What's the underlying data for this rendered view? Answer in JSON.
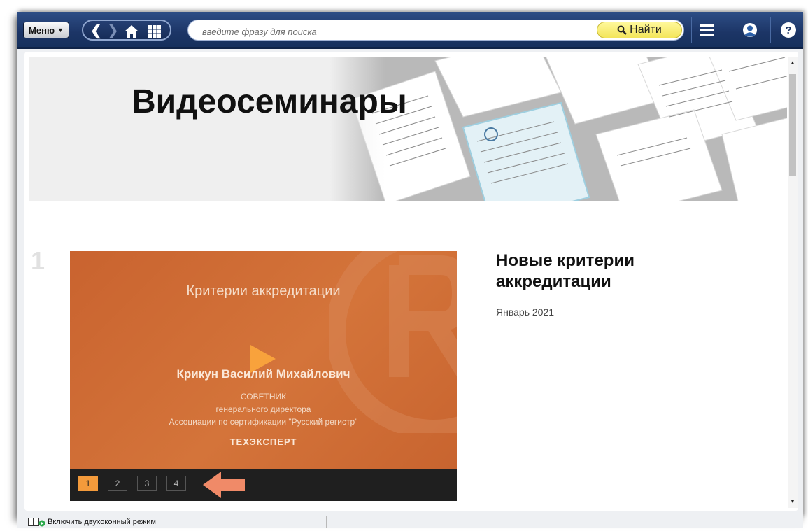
{
  "toolbar": {
    "menu_label": "Меню",
    "search_placeholder": "введите фразу для поиска",
    "search_button_label": "Найти"
  },
  "banner": {
    "title": "Видеосеминары"
  },
  "seminar": {
    "number": "1",
    "title": "Новые критерии аккредитации",
    "date": "Январь 2021",
    "slide": {
      "title": "Критерии аккредитации",
      "speaker": "Крикун Василий Михайлович",
      "position_line1": "СОВЕТНИК",
      "position_line2": "генерального директора",
      "position_line3": "Ассоциации по сертификации \"Русский регистр\"",
      "logo_text": "ТЕХЭКСПЕРТ"
    },
    "pages": [
      "1",
      "2",
      "3",
      "4"
    ],
    "active_page": "1"
  },
  "statusbar": {
    "dual_window_label": "Включить двухоконный режим"
  },
  "colors": {
    "topbar": "#1c3566",
    "search_button": "#f3e55a",
    "slide_background": "#d4743a",
    "active_page": "#f39a3b",
    "arrow": "#f08a68"
  }
}
